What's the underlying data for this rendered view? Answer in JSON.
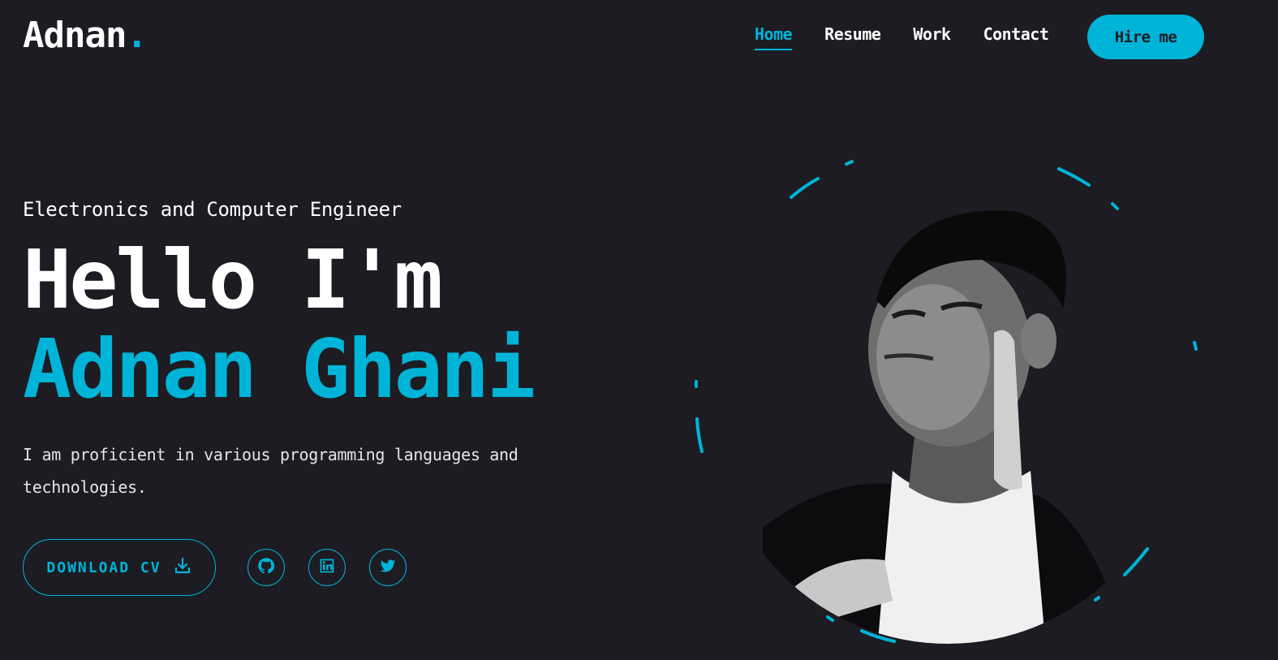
{
  "header": {
    "logo_text": "Adnan",
    "logo_dot": ".",
    "nav": [
      {
        "label": "Home",
        "active": true
      },
      {
        "label": "Resume",
        "active": false
      },
      {
        "label": "Work",
        "active": false
      },
      {
        "label": "Contact",
        "active": false
      }
    ],
    "hire_label": "Hire me"
  },
  "hero": {
    "subtitle": "Electronics and Computer Engineer",
    "greeting": "Hello I'm",
    "name": "Adnan Ghani",
    "description": "I am proficient in various programming languages and technologies.",
    "download_label": "DOWNLOAD CV",
    "download_icon": "download-icon",
    "socials": [
      {
        "name": "github",
        "icon": "github-icon"
      },
      {
        "name": "linkedin",
        "icon": "linkedin-icon"
      },
      {
        "name": "twitter",
        "icon": "twitter-icon"
      }
    ]
  },
  "colors": {
    "background": "#1c1c22",
    "accent": "#00b4d8",
    "text": "#ffffff"
  }
}
